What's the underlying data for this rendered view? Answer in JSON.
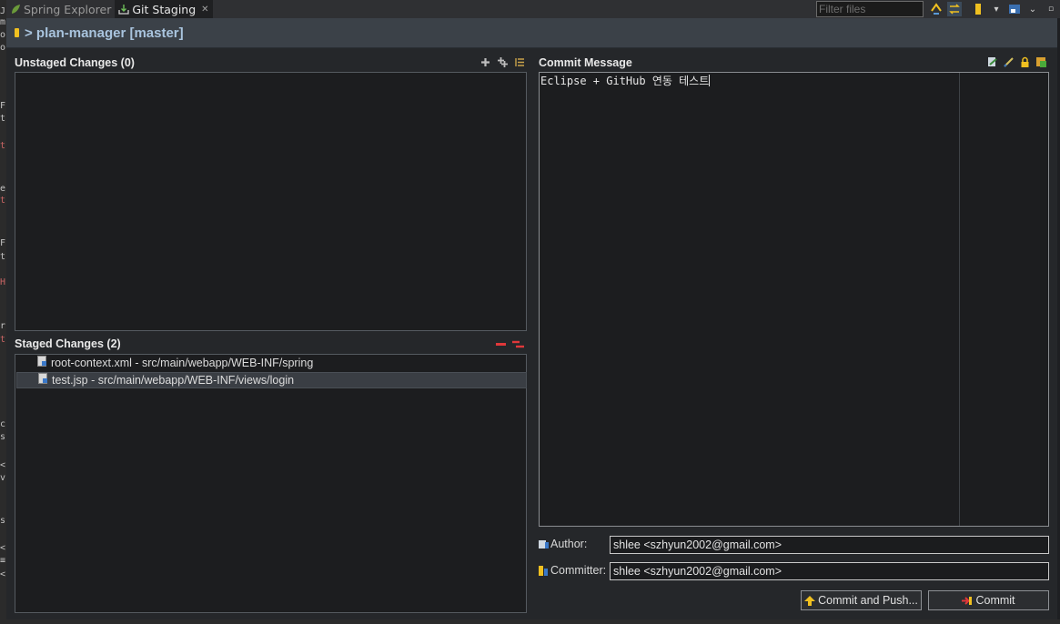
{
  "tabs": [
    {
      "label": "Spring Explorer",
      "icon": "spring-leaf-icon",
      "active": false
    },
    {
      "label": "Git Staging",
      "icon": "git-staging-icon",
      "active": true,
      "close": "✕"
    }
  ],
  "toolbar": {
    "filter_placeholder": "Filter files"
  },
  "repo": {
    "title": "> plan-manager [master]"
  },
  "unstaged": {
    "title": "Unstaged Changes (0)",
    "files": []
  },
  "staged": {
    "title": "Staged Changes (2)",
    "files": [
      {
        "label": "root-context.xml - src/main/webapp/WEB-INF/spring",
        "selected": false
      },
      {
        "label": "test.jsp - src/main/webapp/WEB-INF/views/login",
        "selected": true
      }
    ]
  },
  "commit": {
    "title": "Commit Message",
    "message": "Eclipse + GitHub 연동 테스트",
    "author_label": "Author:",
    "author_value": "shlee <szhyun2002@gmail.com>",
    "committer_label": "Committer:",
    "committer_value": "shlee <szhyun2002@gmail.com>",
    "commit_and_push_label": "Commit and Push...",
    "commit_label": "Commit"
  },
  "colors": {
    "accent": "#a9c4de",
    "remove": "#e0383a",
    "add": "#cfcfcf"
  }
}
